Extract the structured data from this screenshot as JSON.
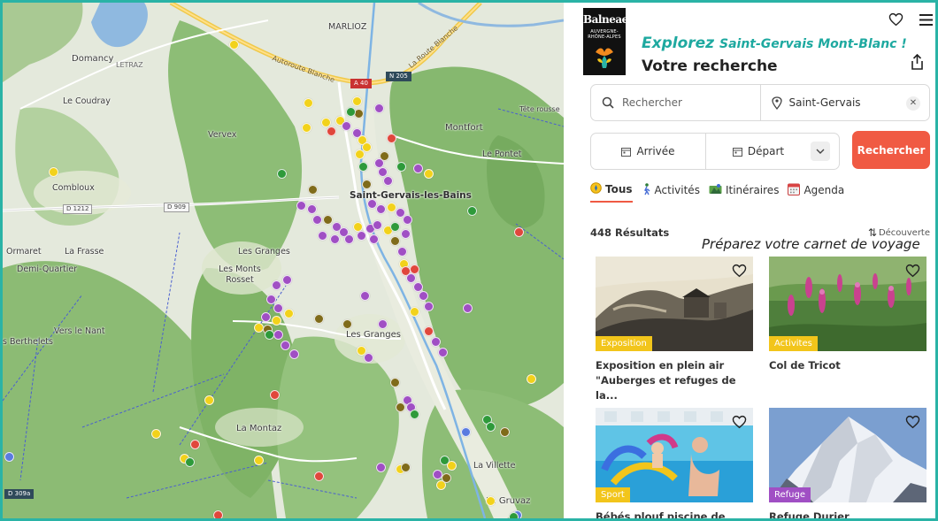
{
  "map": {
    "places": {
      "marlioz": "MARLIOZ",
      "domancy": "Domancy",
      "letraz": "LETRAZ",
      "le_coudray": "Le Coudray",
      "vervex": "Vervex",
      "combloux": "Combloux",
      "montfort": "Montfort",
      "le_pontet": "Le Pontet",
      "tete_rousse": "Tête rousse",
      "saint_gervais": "Saint-Gervais-les-Bains",
      "ormaret": "Ormaret",
      "demi_quartier": "Demi-Quartier",
      "la_frasse": "La Frasse",
      "les_granges_1": "Les Granges",
      "les_monts_rosset": "Les Monts Rosset",
      "vers_le_nant": "Vers le Nant",
      "berthelets": "s Berthelets",
      "les_granges_2": "Les Granges",
      "la_montaz": "La Montaz",
      "la_villette": "La Villette",
      "la_gruvaz": "La Gruvaz"
    },
    "roads": {
      "autoroute": "Autoroute Blanche",
      "route_blanche": "La Route Blanche",
      "a40": "A 40",
      "n205": "N 205",
      "d1212": "D 1212",
      "d909": "D 909",
      "d909a": "D 309a"
    }
  },
  "header": {
    "logo_text": "Balneae",
    "logo_sub": "AUVERGNE-RHÔNE-ALPES",
    "explore_prefix": "Explorez",
    "explore_place": "Saint-Gervais Mont-Blanc !",
    "subtitle": "Votre recherche"
  },
  "search": {
    "query_placeholder": "Rechercher",
    "location_value": "Saint-Gervais",
    "arrival_label": "Arrivée",
    "departure_label": "Départ",
    "search_button": "Rechercher"
  },
  "tabs": [
    {
      "label": "Tous",
      "active": true
    },
    {
      "label": "Activités",
      "active": false
    },
    {
      "label": "Itinéraires",
      "active": false
    },
    {
      "label": "Agenda",
      "active": false
    }
  ],
  "results": {
    "count": "448 Résultats",
    "sort_label": "Découverte",
    "carnet": "Préparez votre carnet de voyage"
  },
  "cards": [
    {
      "category": "Exposition",
      "title": "Exposition en plein air \"Auberges et refuges de la..."
    },
    {
      "category": "Activites",
      "title": "Col de Tricot"
    },
    {
      "category": "Sport",
      "title": "Bébés plouf piscine de Saint-"
    },
    {
      "category": "Refuge",
      "title": "Refuge Durier"
    }
  ],
  "colors": {
    "accent": "#1ea9a0",
    "search_button": "#f05a43",
    "category_yellow": "#f2c51b",
    "category_purple": "#a04fc4",
    "frame": "#2ab3a6"
  }
}
